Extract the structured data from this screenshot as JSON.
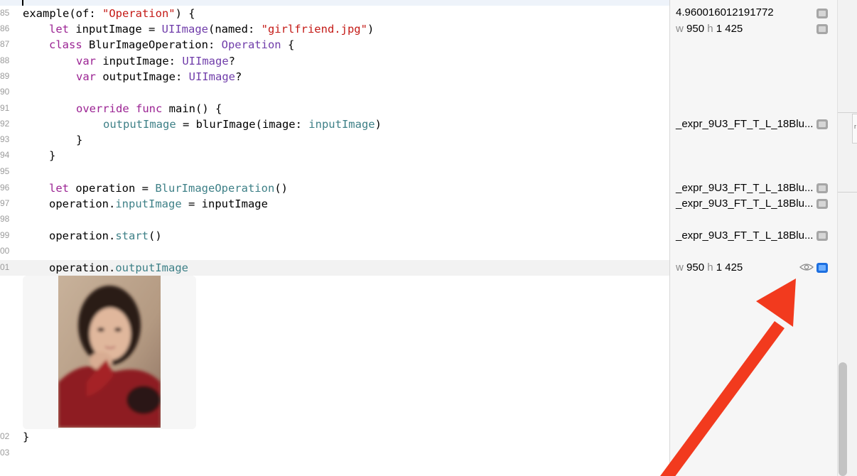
{
  "editor": {
    "line_85": {
      "number": "85",
      "tokens": [
        "example(of: ",
        "\"Operation\"",
        ") {"
      ]
    },
    "line_86": {
      "number": "86",
      "tokens": [
        "let",
        " inputImage = ",
        "UIImage",
        "(named: ",
        "\"girlfriend.jpg\"",
        ")"
      ]
    },
    "line_87": {
      "number": "87",
      "tokens": [
        "class",
        " BlurImageOperation: ",
        "Operation",
        " {"
      ]
    },
    "line_88": {
      "number": "88",
      "tokens": [
        "var",
        " inputImage: ",
        "UIImage",
        "?"
      ]
    },
    "line_89": {
      "number": "89",
      "tokens": [
        "var",
        " outputImage: ",
        "UIImage",
        "?"
      ]
    },
    "line_90": {
      "number": "90"
    },
    "line_91": {
      "number": "91",
      "tokens": [
        "override",
        " ",
        "func",
        " main() {"
      ]
    },
    "line_92": {
      "number": "92",
      "tokens": [
        "outputImage",
        " = blurImage(image: ",
        "inputImage",
        ")"
      ]
    },
    "line_93": {
      "number": "93",
      "tokens": [
        "}"
      ]
    },
    "line_94": {
      "number": "94",
      "tokens": [
        "}"
      ]
    },
    "line_95": {
      "number": "95"
    },
    "line_96": {
      "number": "96",
      "tokens": [
        "let",
        " operation = ",
        "BlurImageOperation",
        "()"
      ]
    },
    "line_97": {
      "number": "97",
      "tokens": [
        "operation.",
        "inputImage",
        " = inputImage"
      ]
    },
    "line_98": {
      "number": "98"
    },
    "line_99": {
      "number": "99",
      "tokens": [
        "operation.",
        "start",
        "()"
      ]
    },
    "line_100": {
      "number": "00"
    },
    "line_101": {
      "number": "01",
      "tokens": [
        "operation.",
        "outputImage"
      ]
    },
    "line_102": {
      "number": "02",
      "tokens": [
        "}"
      ]
    },
    "line_103": {
      "number": "03"
    }
  },
  "results": {
    "r85": {
      "value": "4.960016012191772"
    },
    "r86": {
      "w_label": "w",
      "w_value": "950",
      "h_label": "h",
      "h_value": "1 425"
    },
    "r92": {
      "value": "_expr_9U3_FT_T_L_18Blu..."
    },
    "r96": {
      "value": "_expr_9U3_FT_T_L_18Blu..."
    },
    "r97": {
      "value": "_expr_9U3_FT_T_L_18Blu..."
    },
    "r99": {
      "value": "_expr_9U3_FT_T_L_18Blu..."
    },
    "r101": {
      "w_label": "w",
      "w_value": "950",
      "h_label": "h",
      "h_value": "1 425"
    }
  },
  "icons": {
    "quicklook": "quick-look-icon",
    "result_view": "show-result-icon",
    "eye": "eye-icon",
    "annotation": "red-arrow"
  },
  "colors": {
    "keyword": "#9b2393",
    "type": "#703daa",
    "string": "#c41a16",
    "member": "#3e8087",
    "active_toggle": "#1d6fe0",
    "arrow": "#f23a1e"
  }
}
